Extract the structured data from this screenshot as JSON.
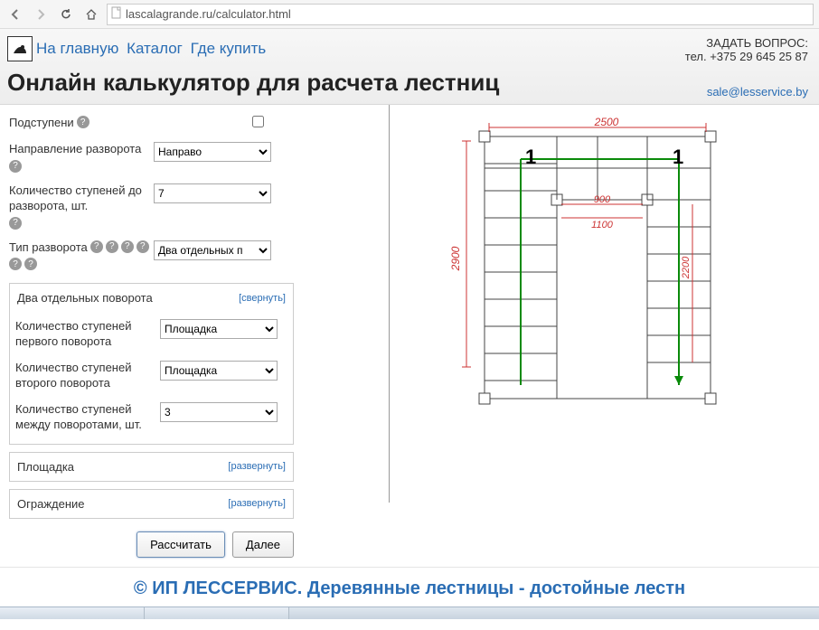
{
  "browser": {
    "url": "lascalagrande.ru/calculator.html"
  },
  "header": {
    "nav": {
      "home": "На главную",
      "catalog": "Каталог",
      "where": "Где купить"
    },
    "title": "Онлайн калькулятор для расчета лестниц",
    "ask": "ЗАДАТЬ ВОПРОС:",
    "phone": "тел. +375 29 645 25 87",
    "email": "sale@lesservice.by"
  },
  "form": {
    "risers_label": "Подступени",
    "direction_label": "Направление разворота",
    "direction_value": "Направо",
    "steps_before_label": "Количество ступеней до разворота, шт.",
    "steps_before_value": "7",
    "turn_type_label": "Тип разворота",
    "turn_type_value": "Два отдельных п"
  },
  "section_two_turns": {
    "title": "Два отдельных поворота",
    "toggle": "[свернуть]",
    "first_turn_label": "Количество ступеней первого поворота",
    "first_turn_value": "Площадка",
    "second_turn_label": "Количество ступеней второго поворота",
    "second_turn_value": "Площадка",
    "between_label": "Количество ступеней между поворотами, шт.",
    "between_value": "3"
  },
  "section_platform": {
    "title": "Площадка",
    "toggle": "[развернуть]"
  },
  "section_railing": {
    "title": "Ограждение",
    "toggle": "[развернуть]"
  },
  "buttons": {
    "calculate": "Рассчитать",
    "next": "Далее"
  },
  "diagram": {
    "dim_top": "2500",
    "dim_inner_w": "900",
    "dim_inner_h": "1100",
    "dim_left": "2900",
    "dim_right": "2200",
    "label_1a": "1",
    "label_1b": "1"
  },
  "footer": {
    "text": "© ИП ЛЕССЕРВИС. Деревянные лестницы - достойные лестн"
  }
}
